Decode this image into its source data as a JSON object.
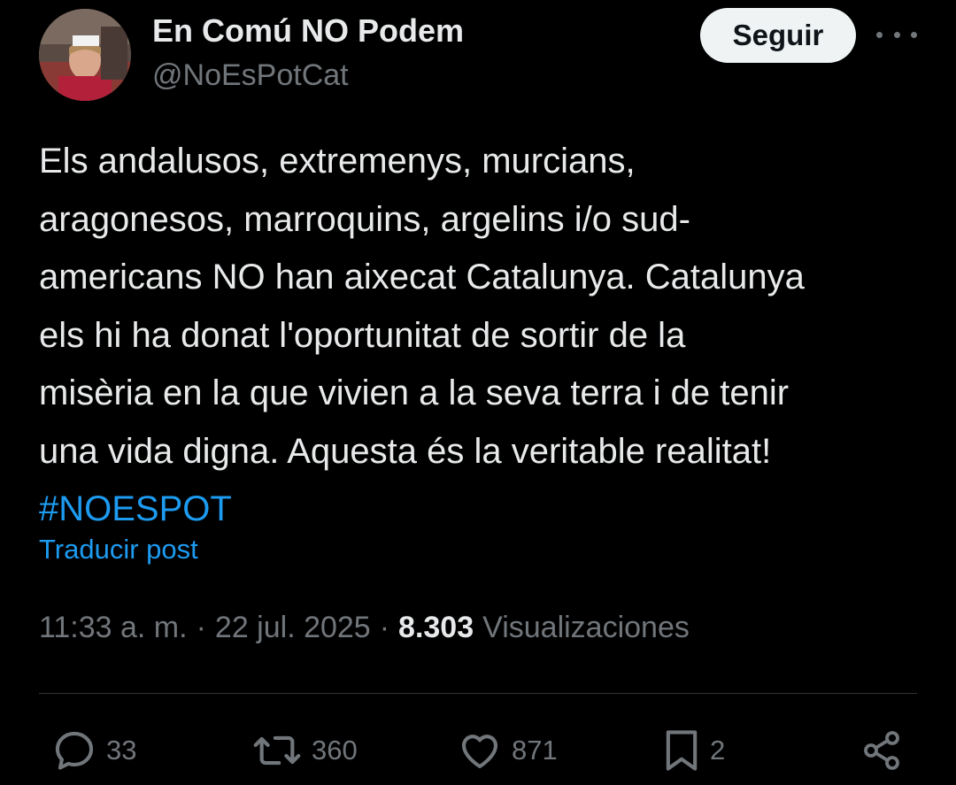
{
  "author": {
    "display_name": "En Comú NO Podem",
    "handle": "@NoEsPotCat",
    "avatar_icon": "profile-photo"
  },
  "header": {
    "follow_label": "Seguir",
    "more_icon": "more-horizontal-icon"
  },
  "post": {
    "lines": [
      "Els andalusos, extremenys, murcians,",
      "aragonesos, marroquins, argelins i/o sud-",
      "americans NO han aixecat Catalunya. Catalunya",
      "els hi ha donat l'oportunitat de sortir de la",
      "misèria en la que vivien a la seva terra i de tenir",
      "una vida digna. Aquesta és la veritable realitat!"
    ],
    "hashtag": "#NOESPOT",
    "translate_label": "Traducir post"
  },
  "meta": {
    "time": "11:33 a. m.",
    "separator": "·",
    "date": "22 jul. 2025",
    "views_count": "8.303",
    "views_label": "Visualizaciones"
  },
  "actions": {
    "replies": "33",
    "reposts": "360",
    "likes": "871",
    "bookmarks": "2"
  },
  "colors": {
    "background": "#000000",
    "text": "#e7e9ea",
    "secondary": "#71767b",
    "accent": "#1d9bf0",
    "follow_bg": "#eff3f4"
  }
}
